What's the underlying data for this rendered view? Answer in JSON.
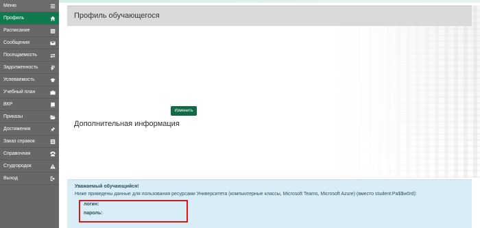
{
  "sidebar": {
    "items": [
      {
        "label": "Меню",
        "icon": "hamburger-icon"
      },
      {
        "label": "Профиль",
        "icon": "home-icon",
        "active": true
      },
      {
        "label": "Расписание",
        "icon": "calendar-icon"
      },
      {
        "label": "Сообщения",
        "icon": "envelope-icon"
      },
      {
        "label": "Посещаемость",
        "icon": "arrows-icon"
      },
      {
        "label": "Задолженность",
        "icon": "ruble-icon"
      },
      {
        "label": "Успеваемость",
        "icon": "graduation-cap-icon"
      },
      {
        "label": "Учебный план",
        "icon": "briefcase-icon"
      },
      {
        "label": "ВКР",
        "icon": "book-icon"
      },
      {
        "label": "Приказы",
        "icon": "folder-open-icon"
      },
      {
        "label": "Достижения",
        "icon": "pushpin-icon"
      },
      {
        "label": "Заказ справок",
        "icon": "list-box-icon"
      },
      {
        "label": "Справочная",
        "icon": "phone-icon"
      },
      {
        "label": "Студгородок",
        "icon": "warning-icon"
      },
      {
        "label": "Выход",
        "icon": "logout-icon"
      }
    ]
  },
  "main": {
    "title": "Профиль обучающегося",
    "edit_button": "Изменить",
    "extra_info_title": "Дополнительная информация"
  },
  "notice": {
    "title": "Уважаемый обучающийся!",
    "text": "Ниже приведены данные для пользования ресурсами Университета (компьютерные классы, Microsoft Teams, Microsoft Azure) (вместо student:Pa$$w0rd):",
    "login_label": "логин:",
    "password_label": "пароль:"
  },
  "colors": {
    "sidebar_bg": "#676767",
    "active_bg": "#0f7a4e",
    "button_bg": "#0f6b45",
    "notice_bg": "#d8edf5",
    "highlight_border": "#d01a1a"
  }
}
